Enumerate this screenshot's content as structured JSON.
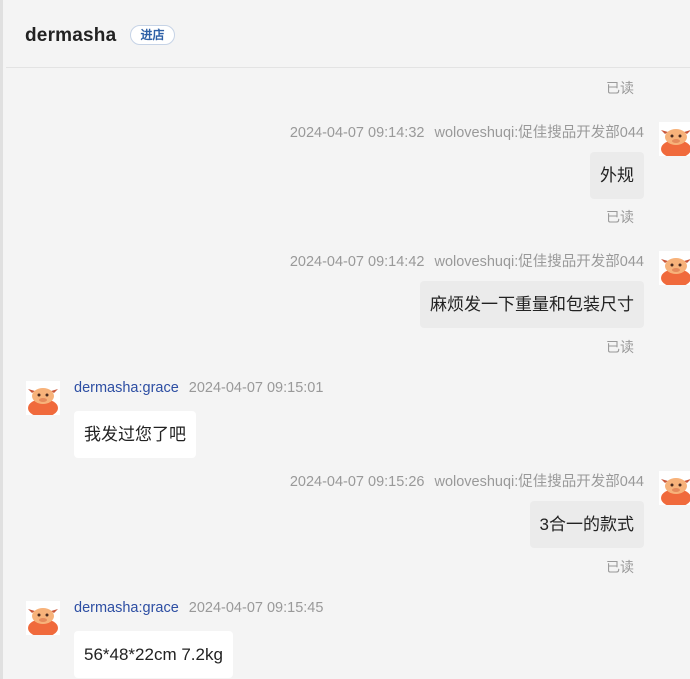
{
  "header": {
    "shop_name": "dermasha",
    "visit_label": "进店"
  },
  "status": {
    "read": "已读"
  },
  "messages": [
    {
      "time": "2024-04-07 09:14:32",
      "sender": "woloveshuqi:促佳搜品开发部044",
      "text": "外规",
      "side": "mine"
    },
    {
      "time": "2024-04-07 09:14:42",
      "sender": "woloveshuqi:促佳搜品开发部044",
      "text": "麻烦发一下重量和包装尺寸",
      "side": "mine"
    },
    {
      "time": "2024-04-07 09:15:01",
      "sender": "dermasha:grace",
      "text": "我发过您了吧",
      "side": "theirs"
    },
    {
      "time": "2024-04-07 09:15:26",
      "sender": "woloveshuqi:促佳搜品开发部044",
      "text": "3合一的款式",
      "side": "mine"
    },
    {
      "time": "2024-04-07 09:15:45",
      "sender": "dermasha:grace",
      "text": "56*48*22cm  7.2kg",
      "side": "theirs"
    }
  ],
  "colors": {
    "background": "#f4f4f4",
    "my_bubble": "#ebebeb",
    "their_bubble": "#ffffff",
    "sender_name_theirs": "#2d4ea3",
    "avatar_body": "#f06a3c",
    "avatar_head": "#f7b27a"
  }
}
